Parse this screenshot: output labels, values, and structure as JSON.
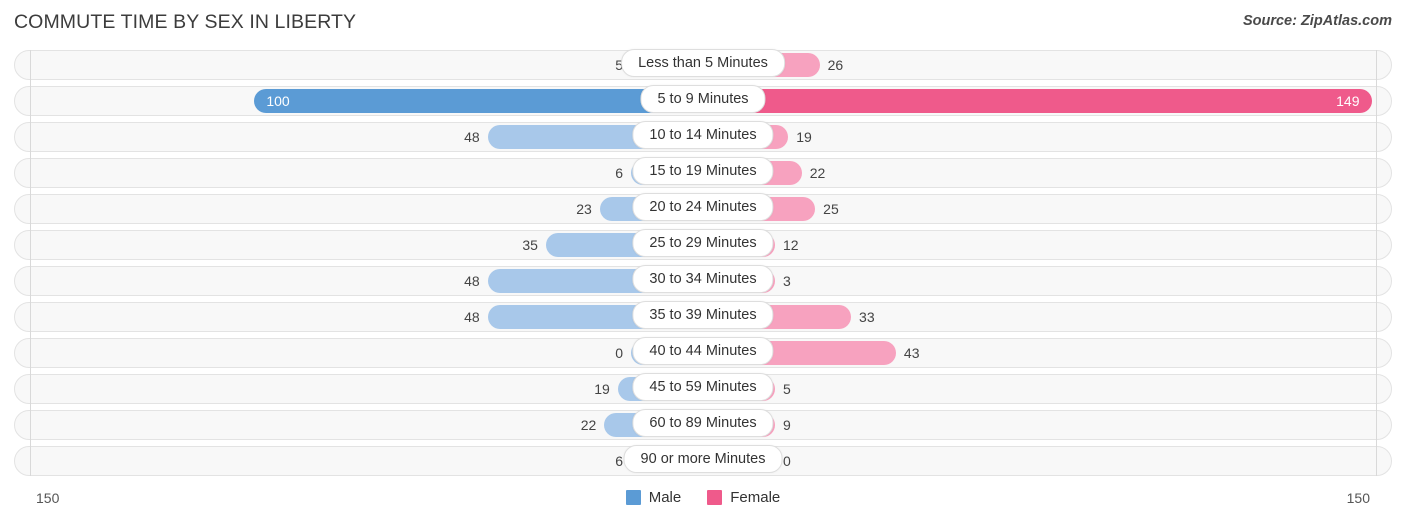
{
  "header": {
    "title": "COMMUTE TIME BY SEX IN LIBERTY",
    "source": "Source: ZipAtlas.com"
  },
  "footer": {
    "axis_max_left": "150",
    "axis_max_right": "150"
  },
  "legend": {
    "items": [
      {
        "label": "Male",
        "color": "#5b9bd5"
      },
      {
        "label": "Female",
        "color": "#ef5a8b"
      }
    ]
  },
  "colors": {
    "male": "#a8c8ea",
    "male_max": "#5b9bd5",
    "female": "#f7a2bf",
    "female_max": "#ef5a8b",
    "track": "#f8f8f8",
    "track_border": "#e3e3e3",
    "axis": "#d9d9d9"
  },
  "chart_data": {
    "type": "bar",
    "subtype": "diverging-bidirectional-bar",
    "title": "COMMUTE TIME BY SEX IN LIBERTY",
    "xlabel": "",
    "ylabel": "",
    "axis_max": 150,
    "xlim": [
      -150,
      150
    ],
    "grid": false,
    "legend_position": "bottom-center",
    "categories": [
      "Less than 5 Minutes",
      "5 to 9 Minutes",
      "10 to 14 Minutes",
      "15 to 19 Minutes",
      "20 to 24 Minutes",
      "25 to 29 Minutes",
      "30 to 34 Minutes",
      "35 to 39 Minutes",
      "40 to 44 Minutes",
      "45 to 59 Minutes",
      "60 to 89 Minutes",
      "90 or more Minutes"
    ],
    "series": [
      {
        "name": "Male",
        "direction": "left",
        "color": "#a8c8ea",
        "max_color": "#5b9bd5",
        "values": [
          5,
          100,
          48,
          6,
          23,
          35,
          48,
          48,
          0,
          19,
          22,
          6
        ]
      },
      {
        "name": "Female",
        "direction": "right",
        "color": "#f7a2bf",
        "max_color": "#ef5a8b",
        "values": [
          26,
          149,
          19,
          22,
          25,
          12,
          3,
          33,
          43,
          5,
          9,
          0
        ]
      }
    ],
    "rows": [
      {
        "category": "Less than 5 Minutes",
        "male": 5,
        "female": 26,
        "male_label": "5",
        "female_label": "26",
        "male_max": false,
        "female_max": false
      },
      {
        "category": "5 to 9 Minutes",
        "male": 100,
        "female": 149,
        "male_label": "100",
        "female_label": "149",
        "male_max": true,
        "female_max": true
      },
      {
        "category": "10 to 14 Minutes",
        "male": 48,
        "female": 19,
        "male_label": "48",
        "female_label": "19",
        "male_max": false,
        "female_max": false
      },
      {
        "category": "15 to 19 Minutes",
        "male": 6,
        "female": 22,
        "male_label": "6",
        "female_label": "22",
        "male_max": false,
        "female_max": false
      },
      {
        "category": "20 to 24 Minutes",
        "male": 23,
        "female": 25,
        "male_label": "23",
        "female_label": "25",
        "male_max": false,
        "female_max": false
      },
      {
        "category": "25 to 29 Minutes",
        "male": 35,
        "female": 12,
        "male_label": "35",
        "female_label": "12",
        "male_max": false,
        "female_max": false
      },
      {
        "category": "30 to 34 Minutes",
        "male": 48,
        "female": 3,
        "male_label": "48",
        "female_label": "3",
        "male_max": false,
        "female_max": false
      },
      {
        "category": "35 to 39 Minutes",
        "male": 48,
        "female": 33,
        "male_label": "48",
        "female_label": "33",
        "male_max": false,
        "female_max": false
      },
      {
        "category": "40 to 44 Minutes",
        "male": 0,
        "female": 43,
        "male_label": "0",
        "female_label": "43",
        "male_max": false,
        "female_max": false
      },
      {
        "category": "45 to 59 Minutes",
        "male": 19,
        "female": 5,
        "male_label": "19",
        "female_label": "5",
        "male_max": false,
        "female_max": false
      },
      {
        "category": "60 to 89 Minutes",
        "male": 22,
        "female": 9,
        "male_label": "22",
        "female_label": "9",
        "male_max": false,
        "female_max": false
      },
      {
        "category": "90 or more Minutes",
        "male": 6,
        "female": 0,
        "male_label": "6",
        "female_label": "0",
        "male_max": false,
        "female_max": false
      }
    ]
  }
}
